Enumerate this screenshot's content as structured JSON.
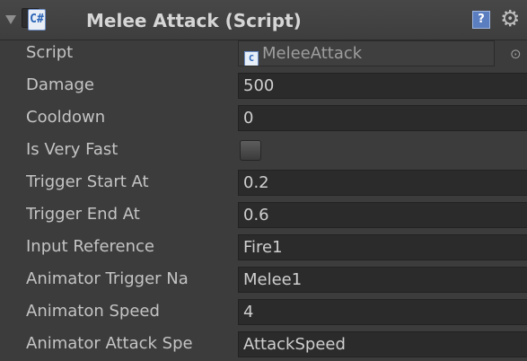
{
  "component": {
    "title": "Melee Attack (Script)"
  },
  "script_field": {
    "label": "Script",
    "value": "MeleeAttack",
    "picker_glyph": "⊙"
  },
  "fields": [
    {
      "label": "Damage",
      "value": "500"
    },
    {
      "label": "Cooldown",
      "value": "0"
    },
    {
      "label": "Is Very Fast",
      "checked": false
    },
    {
      "label": "Trigger Start At",
      "value": "0.2"
    },
    {
      "label": "Trigger End At",
      "value": "0.6"
    },
    {
      "label": "Input Reference",
      "value": "Fire1"
    },
    {
      "label": "Animator Trigger Na",
      "value": "Melee1"
    },
    {
      "label": "Animaton Speed",
      "value": "4"
    },
    {
      "label": "Animator Attack Spe",
      "value": "AttackSpeed"
    }
  ],
  "icons": {
    "script_icon": "csharp-script-icon",
    "help": "help-icon",
    "settings": "gear-icon"
  }
}
